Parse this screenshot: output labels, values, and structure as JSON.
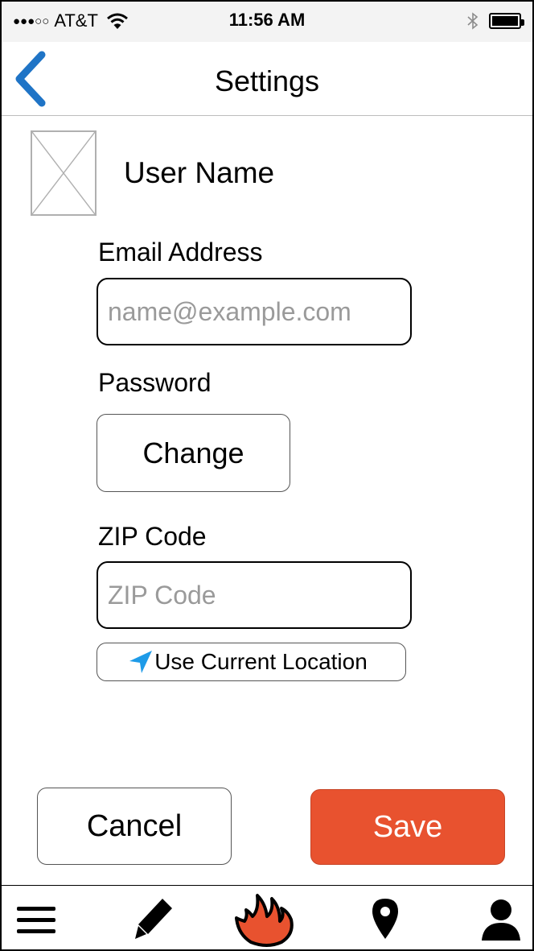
{
  "status_bar": {
    "signal": "●●●○○",
    "carrier": "AT&T",
    "time": "11:56 AM"
  },
  "nav": {
    "title": "Settings"
  },
  "profile": {
    "user_name": "User Name"
  },
  "form": {
    "email_label": "Email Address",
    "email_placeholder": "name@example.com",
    "email_value": "",
    "password_label": "Password",
    "change_label": "Change",
    "zip_label": "ZIP Code",
    "zip_placeholder": "ZIP Code",
    "zip_value": "",
    "location_label": "Use Current Location"
  },
  "actions": {
    "cancel_label": "Cancel",
    "save_label": "Save"
  },
  "tab_bar": {
    "icons": [
      "menu-icon",
      "pencil-icon",
      "flame-icon",
      "location-pin-icon",
      "person-icon"
    ]
  },
  "colors": {
    "accent_blue": "#1f74c6",
    "save_orange": "#e8522f",
    "flame_orange": "#e8522f",
    "location_arrow": "#1e9be8"
  }
}
